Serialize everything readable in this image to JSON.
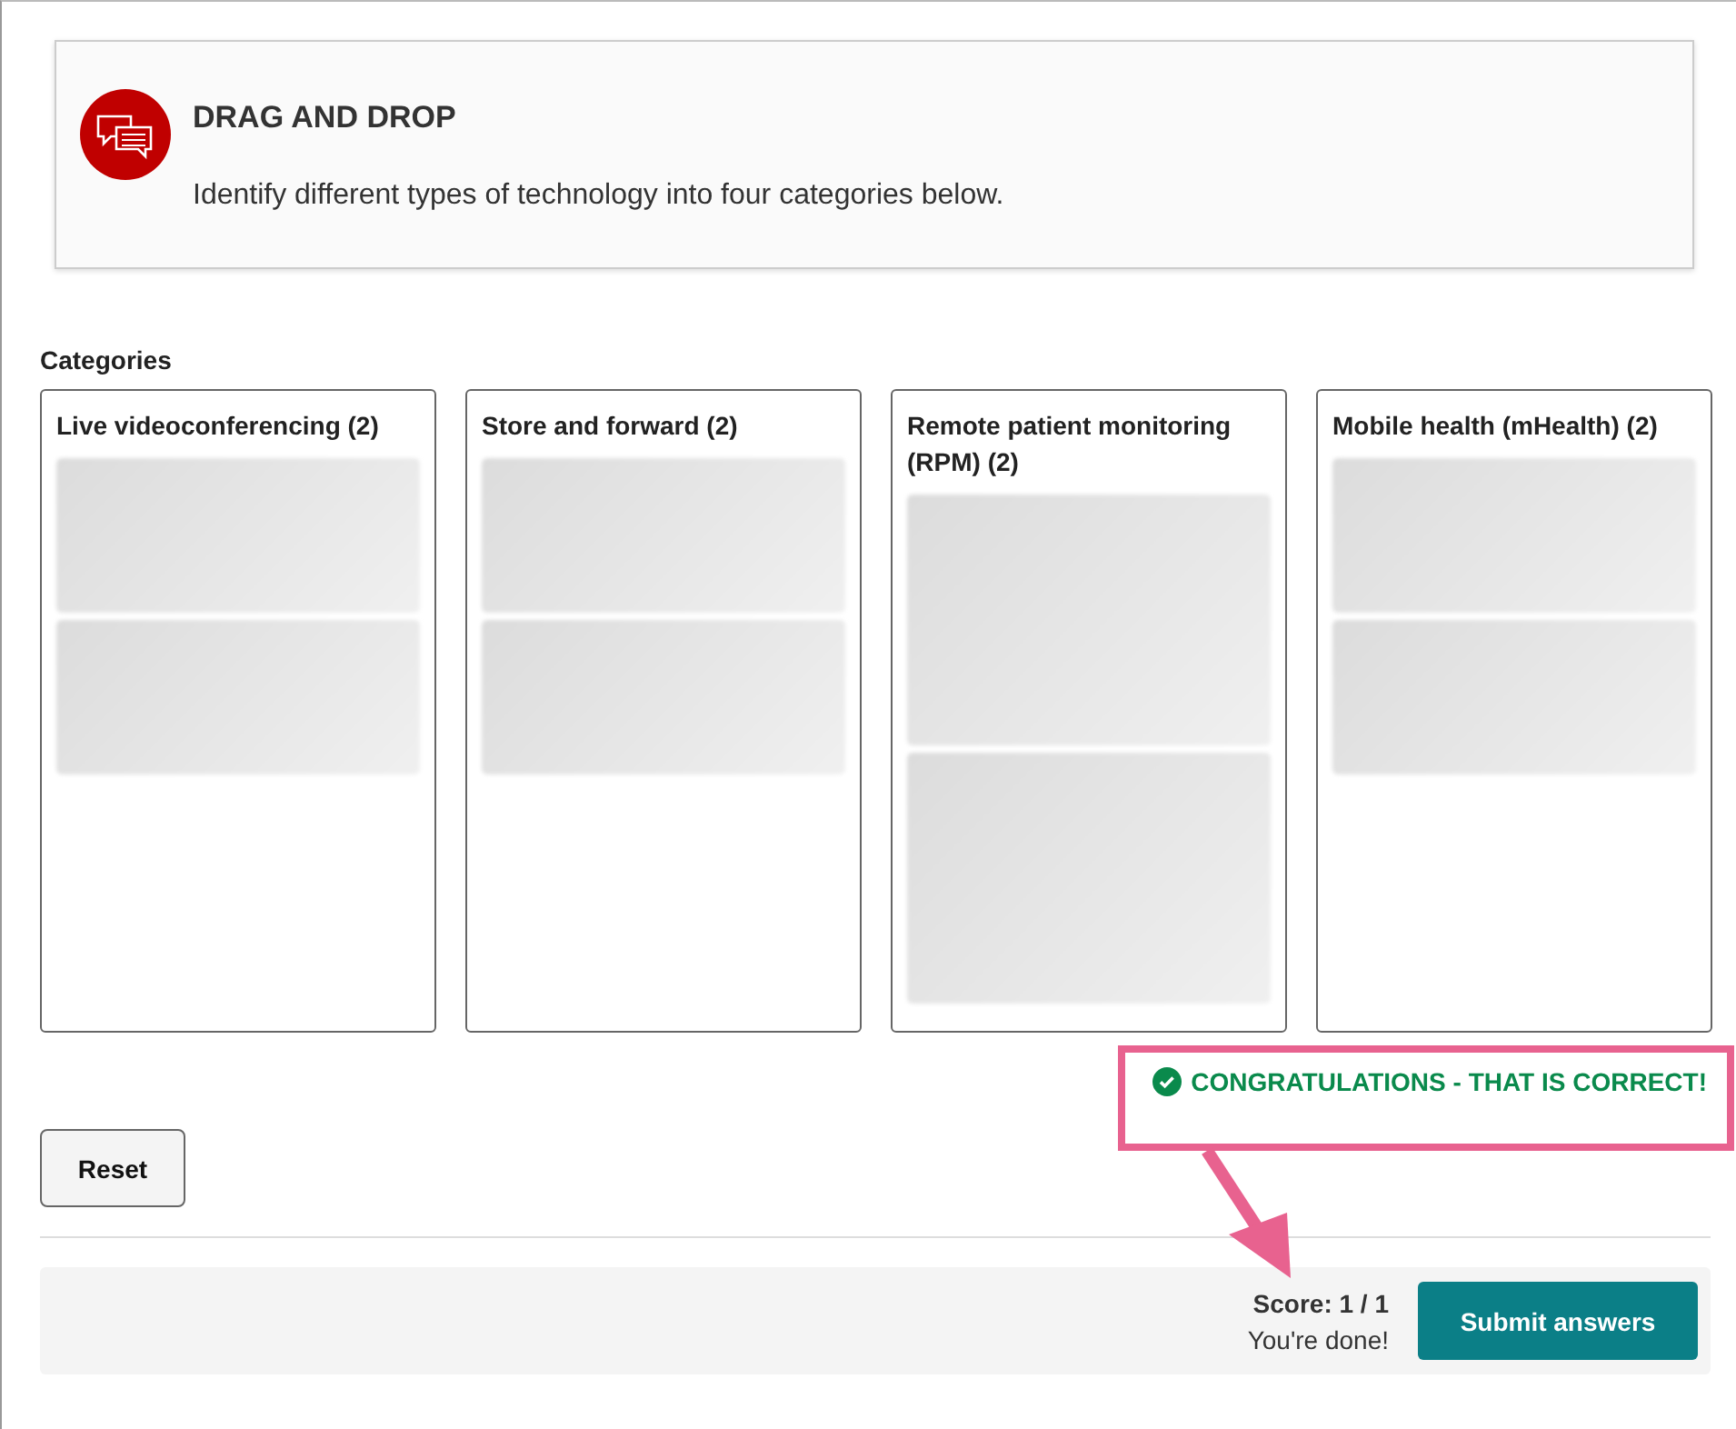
{
  "activity": {
    "title": "DRAG AND DROP",
    "description": "Identify different types of technology into four categories below."
  },
  "categories_label": "Categories",
  "categories": [
    {
      "name": "Live videoconferencing (2)",
      "items": [
        {
          "kind": "blurred"
        },
        {
          "kind": "blurred"
        }
      ]
    },
    {
      "name": "Store and forward (2)",
      "items": [
        {
          "kind": "blurred"
        },
        {
          "kind": "blurred"
        }
      ]
    },
    {
      "name": "Remote patient monitoring (RPM) (2)",
      "items": [
        {
          "kind": "blurred"
        },
        {
          "kind": "blurred"
        }
      ]
    },
    {
      "name": "Mobile health (mHealth) (2)",
      "items": [
        {
          "kind": "blurred"
        },
        {
          "kind": "blurred"
        }
      ]
    }
  ],
  "feedback": {
    "text": "CONGRATULATIONS - THAT IS CORRECT!",
    "correct": true
  },
  "reset_button": "Reset",
  "footer": {
    "score": "Score: 1 / 1",
    "status": "You're done!",
    "submit_button": "Submit answers"
  }
}
